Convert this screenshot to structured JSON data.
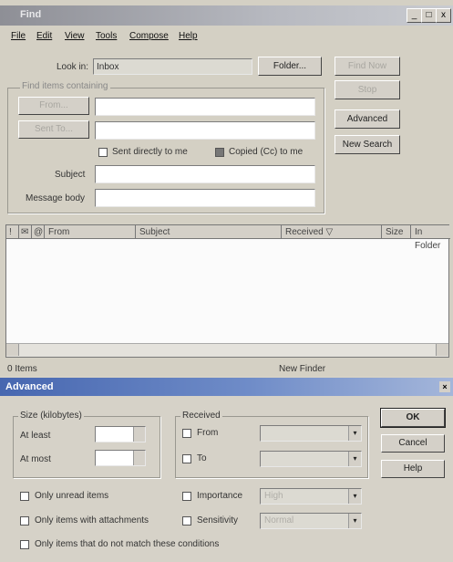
{
  "main": {
    "title": "Find",
    "title_buttons": [
      "_",
      "□",
      "x"
    ],
    "menu": [
      "File",
      "Edit",
      "View",
      "Tools",
      "Compose",
      "Help"
    ],
    "look_in_label": "Look in:",
    "look_in_value": "Inbox",
    "folder_button": "Folder...",
    "find_now_button": "Find Now",
    "stop_button": "Stop",
    "advanced_button": "Advanced",
    "new_search_button": "New Search",
    "find_items_label": "Find items containing",
    "from_button": "From...",
    "sent_to_button": "Sent To...",
    "sent_directly_label": "Sent directly to me",
    "copied_label": "Copied (Cc) to me",
    "subject_label": "Subject",
    "message_body_label": "Message body",
    "columns": [
      "!",
      "✉",
      "@",
      "From",
      "Subject",
      "Received ▽",
      "Size",
      "In Folder"
    ],
    "status_left": "0 Items",
    "status_right": "New Finder"
  },
  "advanced": {
    "title": "Advanced",
    "size_group": "Size (kilobytes)",
    "at_least": "At least",
    "at_most": "At most",
    "received_group": "Received",
    "from_label": "From",
    "to_label": "To",
    "ok_button": "OK",
    "cancel_button": "Cancel",
    "help_button": "Help",
    "only_unread": "Only unread items",
    "importance": "Importance",
    "only_attachments": "Only items with attachments",
    "sensitivity": "Sensitivity",
    "not_match": "Only items that do not match these conditions",
    "importance_value": "High",
    "sensitivity_value": "Normal"
  }
}
